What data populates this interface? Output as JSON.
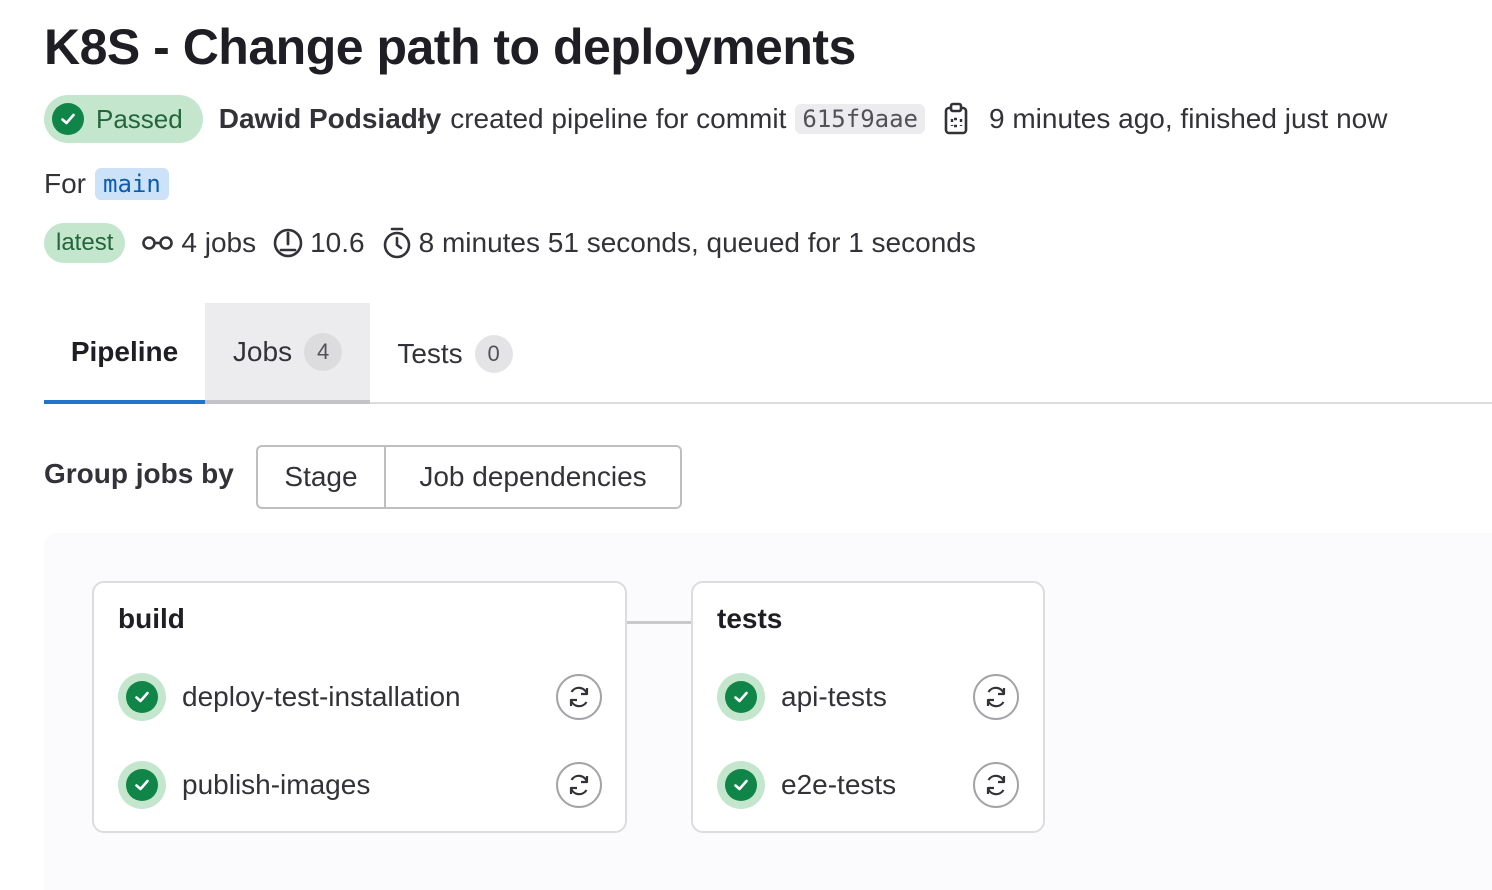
{
  "title": "K8S - Change path to deployments",
  "status": {
    "label": "Passed",
    "color": "#108548"
  },
  "header": {
    "author": "Dawid Podsiadły",
    "action_text": "created pipeline for commit",
    "commit_sha": "615f9aae",
    "copy_icon": "copy-icon",
    "time_text": "9 minutes ago, finished just now"
  },
  "ref": {
    "for_label": "For",
    "branch": "main"
  },
  "meta": {
    "latest_label": "latest",
    "jobs_text": "4 jobs",
    "compute_text": "10.6",
    "duration_text": "8 minutes 51 seconds, queued for 1 seconds"
  },
  "tabs": [
    {
      "label": "Pipeline",
      "count": null
    },
    {
      "label": "Jobs",
      "count": "4"
    },
    {
      "label": "Tests",
      "count": "0"
    }
  ],
  "group_by": {
    "label": "Group jobs by",
    "options": [
      "Stage",
      "Job dependencies"
    ],
    "selected": "Stage"
  },
  "stages": [
    {
      "name": "build",
      "jobs": [
        {
          "name": "deploy-test-installation",
          "status": "success"
        },
        {
          "name": "publish-images",
          "status": "success"
        }
      ]
    },
    {
      "name": "tests",
      "jobs": [
        {
          "name": "api-tests",
          "status": "success"
        },
        {
          "name": "e2e-tests",
          "status": "success"
        }
      ]
    }
  ]
}
